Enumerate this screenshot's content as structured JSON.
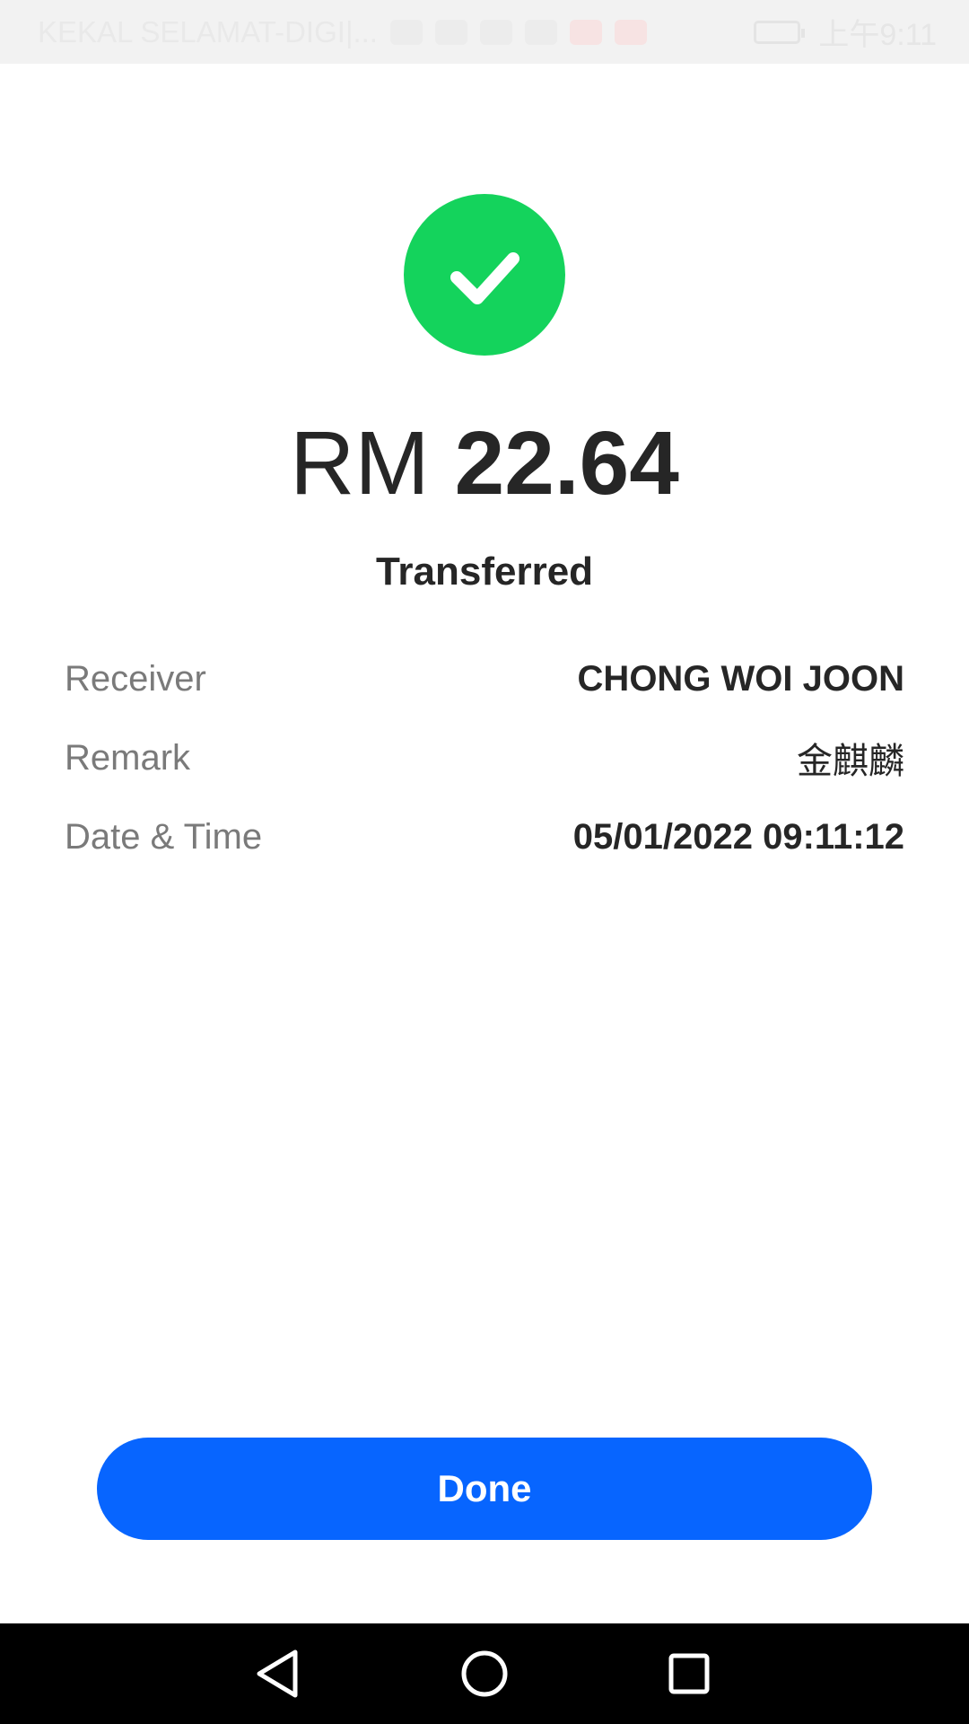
{
  "status_bar": {
    "carrier": "KEKAL SELAMAT-DIGI|...",
    "time": "上午9:11"
  },
  "receipt": {
    "currency": "RM",
    "amount": "22.64",
    "status": "Transferred",
    "details": [
      {
        "label": "Receiver",
        "value": "CHONG WOI JOON"
      },
      {
        "label": "Remark",
        "value": "金麒麟"
      },
      {
        "label": "Date & Time",
        "value": "05/01/2022 09:11:12"
      }
    ]
  },
  "actions": {
    "done_label": "Done"
  },
  "colors": {
    "success": "#14d35c",
    "primary_button": "#0765ff",
    "text_primary": "#262626",
    "text_secondary": "#7a7a7a"
  },
  "icons": {
    "success": "check-icon",
    "nav_back": "back-triangle-icon",
    "nav_home": "home-circle-icon",
    "nav_recents": "recents-square-icon"
  }
}
